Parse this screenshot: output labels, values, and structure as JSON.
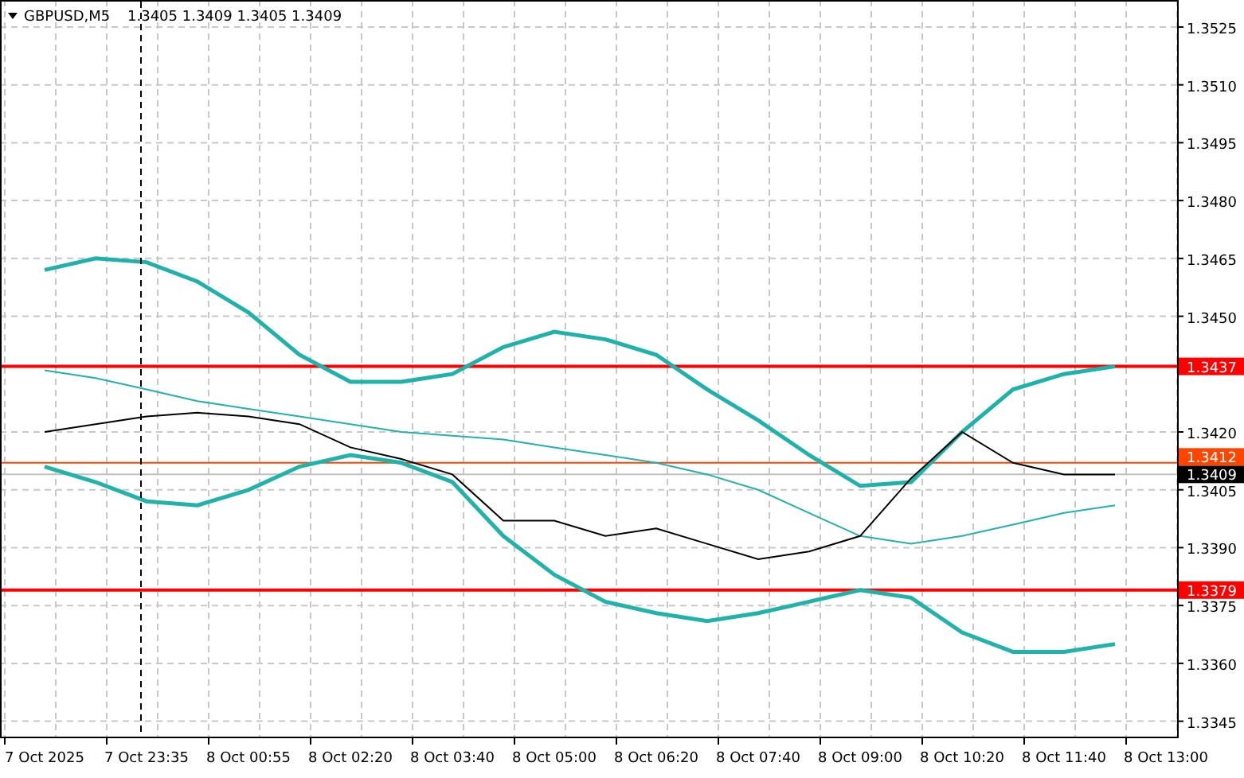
{
  "header": {
    "symbol": "GBPUSD,M5",
    "ohlc": "1.3405 1.3409 1.3405 1.3409"
  },
  "chart": {
    "chart_data": {
      "type": "line",
      "categories": [
        "7 Oct 2025",
        null,
        "7 Oct 23:35",
        null,
        "8 Oct 00:55",
        null,
        "8 Oct 02:20",
        null,
        "8 Oct 03:40",
        null,
        "8 Oct 05:00",
        null,
        "8 Oct 06:20",
        null,
        "8 Oct 07:40",
        null,
        "8 Oct 09:00",
        null,
        "8 Oct 10:20",
        null,
        "8 Oct 11:40",
        null,
        "8 Oct 13:00"
      ],
      "ylim": [
        1.3341,
        1.3532
      ],
      "grid": true,
      "yticks": [
        {
          "value": 1.3525,
          "label": "1.3525"
        },
        {
          "value": 1.351,
          "label": "1.3510"
        },
        {
          "value": 1.3495,
          "label": "1.3495"
        },
        {
          "value": 1.348,
          "label": "1.3480"
        },
        {
          "value": 1.3465,
          "label": "1.3465"
        },
        {
          "value": 1.345,
          "label": "1.3450"
        },
        {
          "value": 1.342,
          "label": "1.3420"
        },
        {
          "value": 1.3405,
          "label": "1.3405"
        },
        {
          "value": 1.339,
          "label": "1.3390"
        },
        {
          "value": 1.3375,
          "label": "1.3375"
        },
        {
          "value": 1.336,
          "label": "1.3360"
        },
        {
          "value": 1.3345,
          "label": "1.3345"
        }
      ],
      "series": [
        {
          "color": "#20b2aa",
          "values": [
            1.3462,
            1.3465,
            1.3464,
            1.3459,
            1.3451,
            1.344,
            1.3433,
            1.3433,
            1.3435,
            1.3442,
            1.3446,
            1.3444,
            1.344,
            1.3431,
            1.3423,
            1.3414,
            1.3406,
            1.3407,
            1.342,
            1.3431,
            1.3435,
            1.3437,
            null
          ]
        },
        {
          "color": "#20b2ab",
          "values": [
            1.3436,
            1.3434,
            1.3431,
            1.3428,
            1.3426,
            1.3424,
            1.3422,
            1.342,
            1.3419,
            1.3418,
            1.3416,
            1.3414,
            1.3412,
            1.3409,
            1.3405,
            1.3399,
            1.3393,
            1.3391,
            1.3393,
            1.3396,
            1.3399,
            1.3401,
            null
          ]
        },
        {
          "color": "#21b2aa",
          "values": [
            1.3411,
            1.3407,
            1.3402,
            1.3401,
            1.3405,
            1.3411,
            1.3414,
            1.3412,
            1.3407,
            1.3393,
            1.3383,
            1.3376,
            1.3373,
            1.3371,
            1.3373,
            1.3376,
            1.3379,
            1.3377,
            1.3368,
            1.3363,
            1.3363,
            1.3365,
            null
          ]
        },
        {
          "color": "#000000",
          "values": [
            1.342,
            1.3422,
            1.3424,
            1.3425,
            1.3424,
            1.3422,
            1.3416,
            1.3413,
            1.3409,
            1.3397,
            1.3397,
            1.3393,
            1.3395,
            1.3391,
            1.3387,
            1.3389,
            1.3393,
            1.3408,
            1.342,
            1.3412,
            1.3409,
            1.3409,
            null
          ]
        }
      ],
      "ref_lines": [
        {
          "axis": "y",
          "value": 1.3437,
          "label": "1.3437",
          "color": "#ff0000"
        },
        {
          "axis": "y",
          "value": 1.3412,
          "label": "1.3412",
          "color": "#ff4500"
        },
        {
          "axis": "y",
          "value": 1.3409,
          "label": "1.3409",
          "color": "#c0c0c0"
        },
        {
          "axis": "y",
          "value": 1.3379,
          "label": "1.3379",
          "color": "#ff0000"
        }
      ]
    }
  }
}
